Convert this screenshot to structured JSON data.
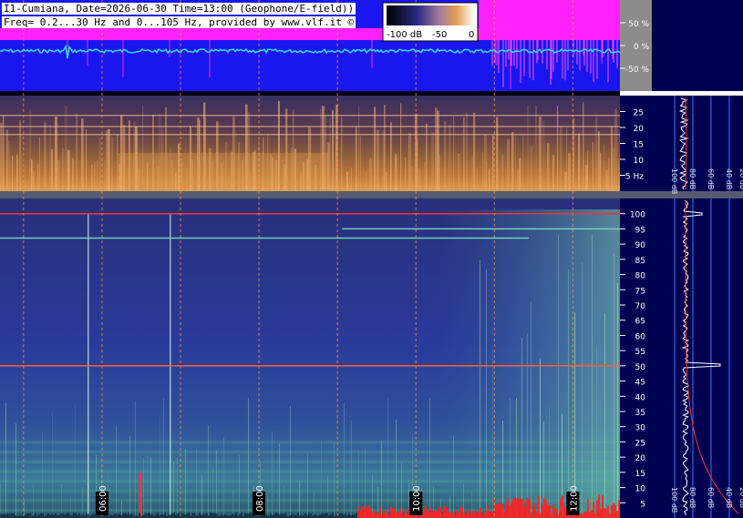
{
  "header": {
    "line1": "I1-Cumiana, Date=2026-06-30 Time=13:00 (Geophone/E-field))",
    "line2": "Freq= 0.2...30 Hz and 0...105 Hz, provided by www.vlf.it ©"
  },
  "colorbar": {
    "ticks": [
      "-100 dB",
      "-50",
      "0"
    ]
  },
  "colors": {
    "waveform_bg": "#1a16f0",
    "waveform_trace": "#28e0e0",
    "saturation": "#ff22ff",
    "spectrogram_low": "#1a1a5a",
    "spectrogram_warm": "#e09040",
    "axis_bg": "#000050",
    "grid_line": "#3a78ff",
    "marker_red": "#ff3030",
    "marker_orange": "#ff9a40"
  },
  "chart_data": [
    {
      "type": "line",
      "panel": "waveform",
      "ylim": [
        -100,
        100
      ],
      "y_ticks": [
        "50 %",
        "0 %",
        "-50 %"
      ],
      "y_tick_values": [
        50,
        0,
        -50
      ]
    },
    {
      "type": "heatmap",
      "panel": "spectrogram-low",
      "ylim": [
        0,
        30
      ],
      "y_ticks": [
        "25",
        "20",
        "15",
        "10",
        "5 Hz"
      ],
      "y_tick_values": [
        25,
        20,
        15,
        10,
        5
      ],
      "side_axis_ticks": [
        "100 dB",
        "80 dB",
        "60 dB",
        "40 dB",
        "20 dB"
      ]
    },
    {
      "type": "heatmap",
      "panel": "spectrogram-high",
      "ylim": [
        0,
        105
      ],
      "y_ticks": [
        "100",
        "95",
        "90",
        "85",
        "80",
        "75",
        "70",
        "65",
        "60",
        "55",
        "50",
        "45",
        "40",
        "35",
        "30",
        "25",
        "20",
        "15",
        "10",
        "5"
      ],
      "y_tick_values": [
        100,
        95,
        90,
        85,
        80,
        75,
        70,
        65,
        60,
        55,
        50,
        45,
        40,
        35,
        30,
        25,
        20,
        15,
        10,
        5
      ],
      "side_axis_ticks": [
        "100 dB",
        "80 dB",
        "60 dB",
        "40 dB",
        "20 dB"
      ],
      "time_labels": [
        "06:00",
        "08:00",
        "10:00",
        "12:00"
      ],
      "time_label_hours": [
        6,
        8,
        10,
        12
      ],
      "time_range_hours": [
        4.7,
        12.6
      ],
      "spectral_lines_hz": [
        100,
        95,
        92,
        50
      ]
    }
  ]
}
